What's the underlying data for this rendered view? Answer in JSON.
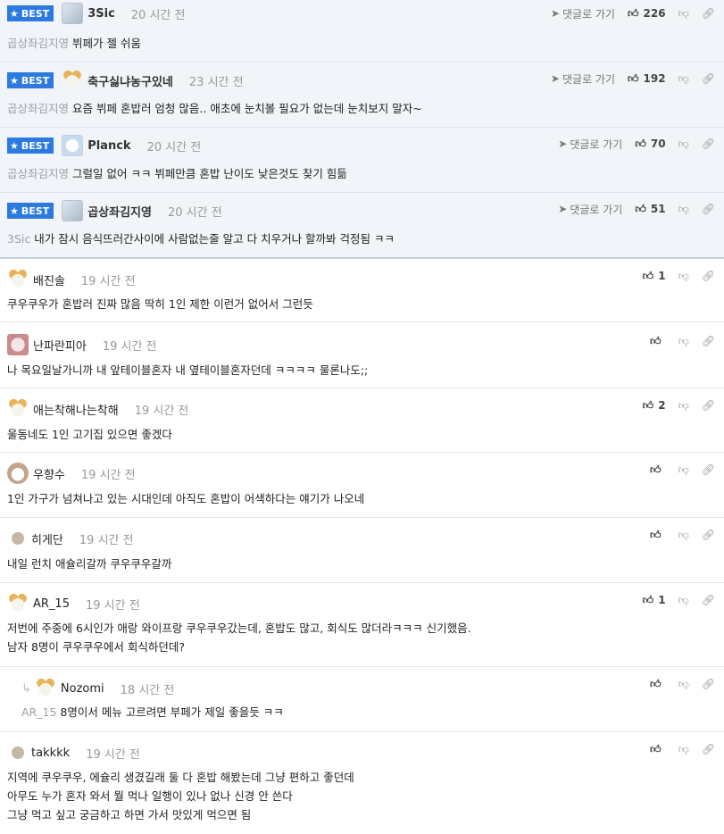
{
  "best_badge": "BEST",
  "reply_label": "댓글로 가기",
  "best": [
    {
      "nick": "3Sic",
      "time": "20 시간 전",
      "mention": "곱상좌김지영",
      "text": "뷔페가 젤 쉬움",
      "likes": "226"
    },
    {
      "nick": "축구싫냐농구있네",
      "time": "23 시간 전",
      "mention": "곱상좌김지영",
      "text": "요즘 뷔페 혼밥러 엄청 많음.. 애초에 눈치볼 필요가 없는데 눈치보지 말자~",
      "likes": "192"
    },
    {
      "nick": "Planck",
      "time": "20 시간 전",
      "mention": "곱상좌김지영",
      "text": "그럴일 없어 ㅋㅋ 뷔페만큼 혼밥 난이도 낮은것도 찾기 힘듦",
      "likes": "70"
    },
    {
      "nick": "곱상좌김지영",
      "time": "20 시간 전",
      "mention": "3Sic",
      "text": "내가 잠시 음식뜨러간사이에 사람없는줄 알고 다 치우거나 할까봐 걱정됨 ㅋㅋ",
      "likes": "51"
    }
  ],
  "comments": [
    {
      "nick": "배진솔",
      "time": "19 시간 전",
      "lines": [
        "쿠우쿠우가 혼밥러 진짜 많음 딱히 1인 제한 이런거 없어서 그런듯"
      ],
      "likes": "1"
    },
    {
      "nick": "난파란피아",
      "time": "19 시간 전",
      "lines": [
        "나 목요일날가니까 내 앞테이블혼자 내 옆테이블혼자던데 ㅋㅋㅋㅋ 물론나도;;"
      ],
      "likes": ""
    },
    {
      "nick": "애는착해나는착해",
      "time": "19 시간 전",
      "lines": [
        "울동네도 1인 고기집 있으면 좋겠다"
      ],
      "likes": "2"
    },
    {
      "nick": "우향수",
      "time": "19 시간 전",
      "lines": [
        "1인 가구가 넘쳐나고 있는 시대인데 아직도 혼밥이 어색하다는 얘기가 나오네"
      ],
      "likes": ""
    },
    {
      "nick": "히게단",
      "time": "19 시간 전",
      "lines": [
        "내일 런치 애슐리갈까 쿠우쿠우갈까"
      ],
      "likes": ""
    },
    {
      "nick": "AR_15",
      "time": "19 시간 전",
      "lines": [
        "저번에 주중에 6시인가 애랑 와이프랑 쿠우쿠우갔는데, 혼밥도 많고, 회식도 많더라ㅋㅋㅋ 신기했음.",
        "남자 8명이 쿠우쿠우에서 회식하던데?"
      ],
      "likes": "1"
    },
    {
      "nick": "Nozomi",
      "time": "18 시간 전",
      "mention": "AR_15",
      "lines": [
        "8명이서 메뉴 고르려면 부페가 제일 좋을듯 ㅋㅋ"
      ],
      "likes": ""
    },
    {
      "nick": "takkkk",
      "time": "19 시간 전",
      "lines": [
        "지역에 쿠우쿠우, 에슐리 생겼길래 둘 다 혼밥 해봤는데 그냥 편하고 좋던데",
        "아무도 누가 혼자 와서 뭘 먹나 일행이 있나 없나 신경 안 쓴다",
        "그냥 먹고 싶고 궁금하고 하면 가서 맛있게 먹으면 됨"
      ],
      "likes": ""
    }
  ]
}
